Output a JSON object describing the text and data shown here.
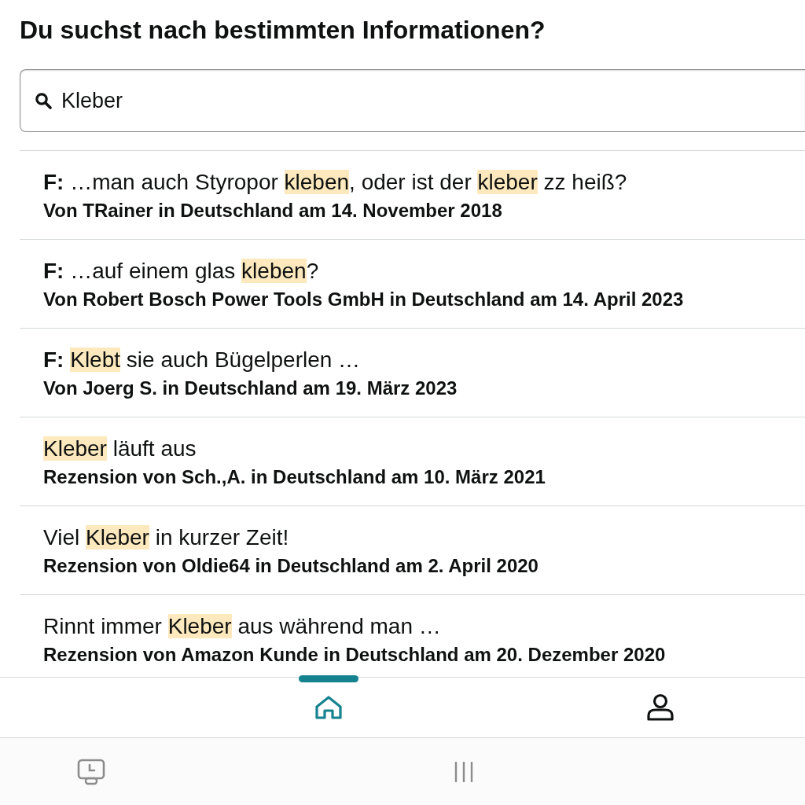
{
  "heading": "Du suchst nach bestimmten Informationen?",
  "search": {
    "value": "Kleber"
  },
  "results": [
    {
      "title": [
        {
          "text": "**F:** …man auch Styropor ",
          "highlight": false
        },
        {
          "text": "kleben",
          "highlight": true
        },
        {
          "text": ", oder ist der ",
          "highlight": false
        },
        {
          "text": "kleber",
          "highlight": true
        },
        {
          "text": " zz heiß?",
          "highlight": false
        }
      ],
      "meta": "Von TRainer in Deutschland am 14. November 2018"
    },
    {
      "title": [
        {
          "text": "**F:** …auf einem glas ",
          "highlight": false
        },
        {
          "text": "kleben",
          "highlight": true
        },
        {
          "text": "?",
          "highlight": false
        }
      ],
      "meta": "Von Robert Bosch Power Tools GmbH in Deutschland am 14. April 2023"
    },
    {
      "title": [
        {
          "text": "**F:** ",
          "highlight": false
        },
        {
          "text": "Klebt",
          "highlight": true
        },
        {
          "text": " sie auch Bügelperlen …",
          "highlight": false
        }
      ],
      "meta": "Von Joerg S. in Deutschland am 19. März 2023"
    },
    {
      "title": [
        {
          "text": "Kleber",
          "highlight": true
        },
        {
          "text": " läuft aus",
          "highlight": false
        }
      ],
      "meta": "Rezension von Sch.,A. in Deutschland am 10. März 2021"
    },
    {
      "title": [
        {
          "text": "Viel ",
          "highlight": false
        },
        {
          "text": "Kleber",
          "highlight": true
        },
        {
          "text": " in kurzer Zeit!",
          "highlight": false
        }
      ],
      "meta": "Rezension von Oldie64 in Deutschland am 2. April 2020"
    },
    {
      "title": [
        {
          "text": "Rinnt immer ",
          "highlight": false
        },
        {
          "text": "Kleber",
          "highlight": true
        },
        {
          "text": " aus während man …",
          "highlight": false
        }
      ],
      "meta": "Rezension von Amazon Kunde in Deutschland am 20. Dezember 2020"
    }
  ],
  "bottom_nav": {
    "items": [
      {
        "kind": "home",
        "selected": true
      },
      {
        "kind": "profile",
        "selected": false
      }
    ]
  }
}
